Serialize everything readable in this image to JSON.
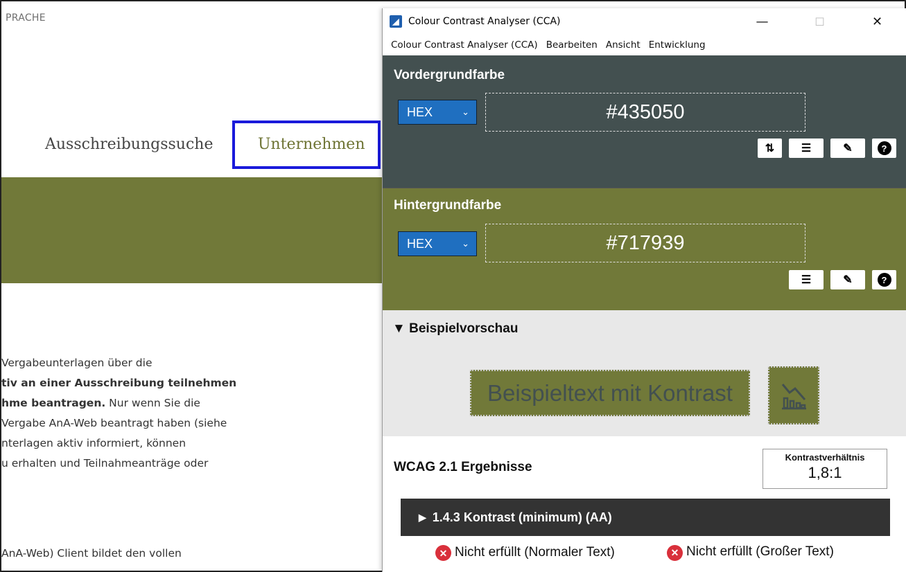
{
  "background_page": {
    "language_label": "PRACHE",
    "nav": {
      "search": "Ausschreibungssuche",
      "company": "Unternehmen"
    },
    "body_lines": [
      {
        "plain": "Vergabeunterlagen über die",
        "bold": ""
      },
      {
        "plain": "",
        "bold": "tiv an einer Ausschreibung teilnehmen"
      },
      {
        "bold": "hme beantragen.",
        "plain": " Nur wenn Sie die"
      },
      {
        "plain": "Vergabe AnA-Web beantragt haben (siehe",
        "bold": ""
      },
      {
        "plain": "nterlagen aktiv informiert, können",
        "bold": ""
      },
      {
        "plain": "u erhalten und Teilnahmeanträge oder",
        "bold": ""
      }
    ],
    "body_line_bottom": "AnA-Web) Client bildet den vollen"
  },
  "cca": {
    "window_title": "Colour Contrast Analyser (CCA)",
    "window_controls": {
      "minimize": "—",
      "maximize": "☐",
      "close": "✕"
    },
    "menu": [
      "Colour Contrast Analyser (CCA)",
      "Bearbeiten",
      "Ansicht",
      "Entwicklung"
    ],
    "foreground": {
      "title": "Vordergrundfarbe",
      "format": "HEX",
      "value": "#435050",
      "color": "#435050",
      "tools": [
        "swap-icon",
        "sliders-icon",
        "eyedropper-icon",
        "help-icon"
      ]
    },
    "background": {
      "title": "Hintergrundfarbe",
      "format": "HEX",
      "value": "#717939",
      "color": "#717939",
      "tools": [
        "sliders-icon",
        "eyedropper-icon",
        "help-icon"
      ]
    },
    "preview": {
      "title": "Beispielvorschau",
      "sample_text": "Beispieltext mit Kontrast"
    },
    "results": {
      "title": "WCAG 2.1 Ergebnisse",
      "ratio_label": "Kontrastverhältnis",
      "ratio_value": "1,8:1",
      "criterion": "1.4.3 Kontrast (minimum) (AA)",
      "normal_text_result": "Nicht erfüllt (Normaler Text)",
      "large_text_result": "Nicht erfüllt (Großer Text)"
    }
  }
}
